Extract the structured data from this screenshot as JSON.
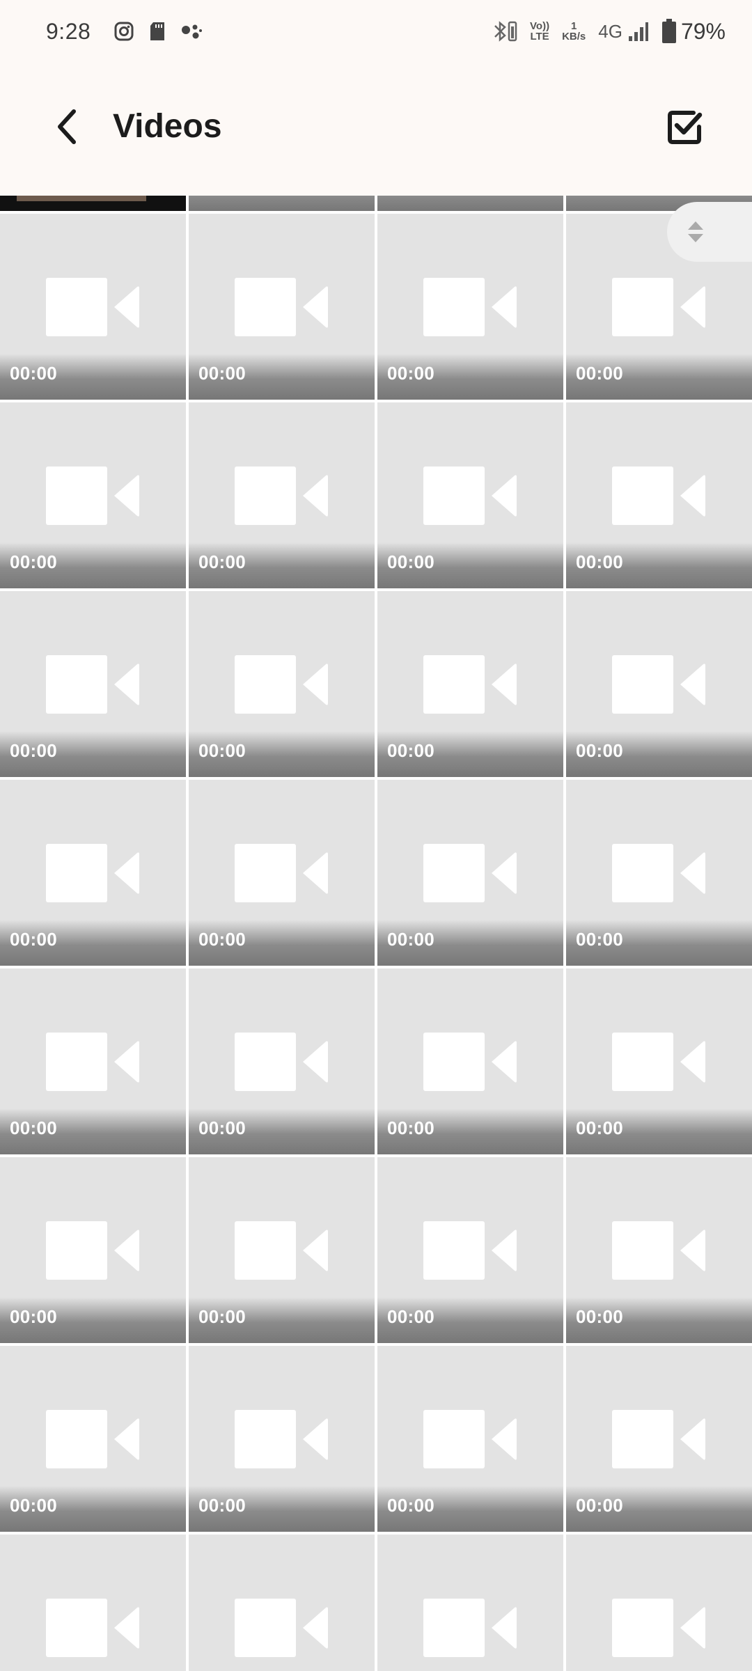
{
  "status_bar": {
    "time": "9:28",
    "left_icons": [
      "instagram-icon",
      "sd-card-icon",
      "assistant-dots-icon"
    ],
    "right_icons": [
      "bluetooth-icon",
      "volte-icon",
      "network-speed",
      "signal-icon",
      "battery-icon"
    ],
    "volte_top": "Vo))",
    "volte_bottom": "LTE",
    "speed_value": "1",
    "speed_unit": "KB/s",
    "network_type": "4G",
    "battery_percent": "79%"
  },
  "header": {
    "title": "Videos",
    "back_icon": "chevron-left-icon",
    "select_icon": "checkbox-checked-icon"
  },
  "grid": {
    "columns": 4,
    "placeholder_icon": "video-camera-icon",
    "colors": {
      "tile_bg": "#e3e3e3",
      "icon": "#ffffff",
      "gap": "#ffffff"
    },
    "tiles": [
      {
        "duration": "00:00"
      },
      {
        "duration": "00:00"
      },
      {
        "duration": "00:00"
      },
      {
        "duration": "00:00"
      },
      {
        "duration": "00:00"
      },
      {
        "duration": "00:00"
      },
      {
        "duration": "00:00"
      },
      {
        "duration": "00:00"
      },
      {
        "duration": "00:00"
      },
      {
        "duration": "00:00"
      },
      {
        "duration": "00:00"
      },
      {
        "duration": "00:00"
      },
      {
        "duration": "00:00"
      },
      {
        "duration": "00:00"
      },
      {
        "duration": "00:00"
      },
      {
        "duration": "00:00"
      },
      {
        "duration": "00:00"
      },
      {
        "duration": "00:00"
      },
      {
        "duration": "00:00"
      },
      {
        "duration": "00:00"
      },
      {
        "duration": "00:00"
      },
      {
        "duration": "00:00"
      },
      {
        "duration": "00:00"
      },
      {
        "duration": "00:00"
      },
      {
        "duration": "00:00"
      },
      {
        "duration": "00:00"
      },
      {
        "duration": "00:00"
      },
      {
        "duration": "00:00"
      },
      {
        "duration": ""
      },
      {
        "duration": ""
      },
      {
        "duration": ""
      },
      {
        "duration": ""
      }
    ]
  },
  "scroll_handle": {
    "icon": "sort-arrows-icon"
  }
}
